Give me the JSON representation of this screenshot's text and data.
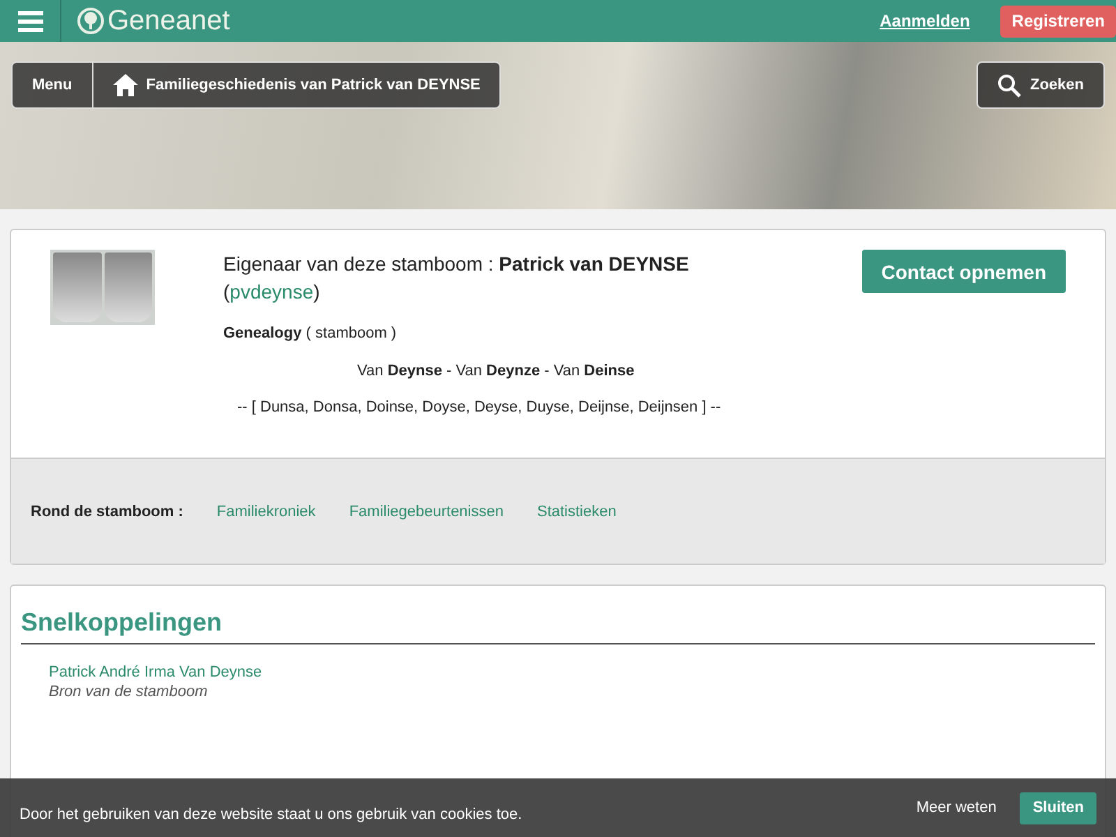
{
  "header": {
    "logo_text": "Geneanet",
    "login": "Aanmelden",
    "register": "Registreren"
  },
  "hero": {
    "menu": "Menu",
    "breadcrumb": "Familiegeschiedenis van Patrick van DEYNSE",
    "search": "Zoeken"
  },
  "owner_card": {
    "owner": "Eigenaar van deze stamboom : **Patrick van DEYNSE**",
    "login_prefix": "(",
    "login": "pvdeynse",
    "login_suffix": ")",
    "contact_button": "Contact opnemen",
    "genealogy": "**Genealogy**  ( stamboom )",
    "names_line": "Van **Deynse** - Van **Deynze** - Van **Deinse**",
    "variants_line": "-- [ Dunsa, Donsa, Doinse, Doyse, Deyse, Duyse, Deijnse, Deijnsen ] --",
    "around_label": "Rond de stamboom :",
    "around_links": [
      "Familiekroniek",
      "Familiegebeurtenissen",
      "Statistieken"
    ]
  },
  "quick_links": {
    "title": "Snelkoppelingen",
    "items": [
      {
        "name": "Patrick André Irma Van Deynse",
        "note": "Bron van de stamboom"
      }
    ]
  },
  "cookie_bar": {
    "text": "Door het gebruiken van deze website staat u ons gebruik van cookies toe.",
    "more": "Meer weten",
    "close": "Sluiten"
  }
}
